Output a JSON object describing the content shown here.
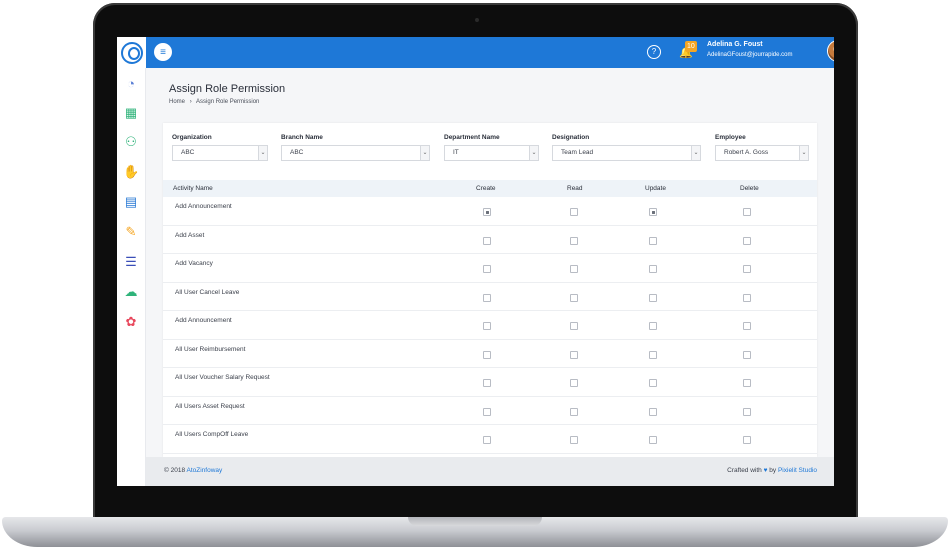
{
  "topbar": {
    "notification_count": "10",
    "user_name": "Adelina G. Foust",
    "user_email": "AdelinaGFoust@jourrapide.com"
  },
  "page": {
    "title": "Assign Role Permission",
    "breadcrumb": [
      "Home",
      "›",
      "Assign Role Permission"
    ]
  },
  "filters": {
    "organization": {
      "label": "Organization",
      "value": "ABC"
    },
    "branch": {
      "label": "Branch Name",
      "value": "ABC"
    },
    "department": {
      "label": "Department Name",
      "value": "IT"
    },
    "designation": {
      "label": "Designation",
      "value": "Team Lead"
    },
    "employee": {
      "label": "Employee",
      "value": "Robert A. Goss"
    }
  },
  "table": {
    "headers": [
      "Activity Name",
      "Create",
      "Read",
      "Update",
      "Delete"
    ],
    "rows": [
      {
        "name": "Add Announcement",
        "create": true,
        "read": false,
        "update": true,
        "delete": false
      },
      {
        "name": "Add Asset",
        "create": false,
        "read": false,
        "update": false,
        "delete": false
      },
      {
        "name": "Add Vacancy",
        "create": false,
        "read": false,
        "update": false,
        "delete": false
      },
      {
        "name": "All User Cancel Leave",
        "create": false,
        "read": false,
        "update": false,
        "delete": false
      },
      {
        "name": "Add Announcement",
        "create": false,
        "read": false,
        "update": false,
        "delete": false
      },
      {
        "name": "All User Reimbursement",
        "create": false,
        "read": false,
        "update": false,
        "delete": false
      },
      {
        "name": "All User Voucher Salary Request",
        "create": false,
        "read": false,
        "update": false,
        "delete": false
      },
      {
        "name": "All Users Asset Request",
        "create": false,
        "read": false,
        "update": false,
        "delete": false
      },
      {
        "name": "All Users CompOff Leave",
        "create": false,
        "read": false,
        "update": false,
        "delete": false
      }
    ]
  },
  "footer": {
    "copyright_prefix": "© 2018",
    "brand": "AtoZinfoway",
    "crafted_prefix": "Crafted with",
    "crafted_by": "by",
    "studio": "Pixielit Studio"
  },
  "icons": {
    "sidebar": [
      "dashboard-icon",
      "calendar-icon",
      "users-icon",
      "hand-money-icon",
      "payroll-icon",
      "leave-icon",
      "reports-icon",
      "chat-icon",
      "settings-icon"
    ],
    "sidebar_colors": [
      "#5b7fd6",
      "#2fb37a",
      "#2fb37a",
      "#e8475c",
      "#2a7ad5",
      "#f5a623",
      "#3a4eb8",
      "#2fb37a",
      "#e8475c"
    ]
  },
  "colors": {
    "primary": "#1e78d7",
    "badge": "#f5a623"
  }
}
